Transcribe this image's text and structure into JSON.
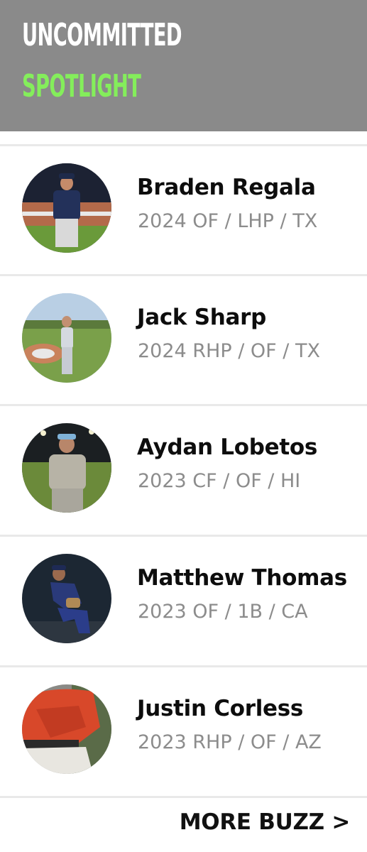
{
  "header": {
    "line1": "UNCOMMITTED",
    "line2": "SPOTLIGHT",
    "bg_color": "#8a8a8a",
    "line1_color": "#ffffff",
    "line2_color": "#84ee5b"
  },
  "players": [
    {
      "name": "Braden Regala",
      "meta": "2024 OF / LHP / TX"
    },
    {
      "name": "Jack Sharp",
      "meta": "2024 RHP / OF / TX"
    },
    {
      "name": "Aydan Lobetos",
      "meta": "2023 CF / OF / HI"
    },
    {
      "name": "Matthew Thomas",
      "meta": "2023 OF / 1B / CA"
    },
    {
      "name": "Justin Corless",
      "meta": "2023 RHP / OF / AZ"
    }
  ],
  "footer": {
    "more_label": "MORE BUZZ >"
  }
}
